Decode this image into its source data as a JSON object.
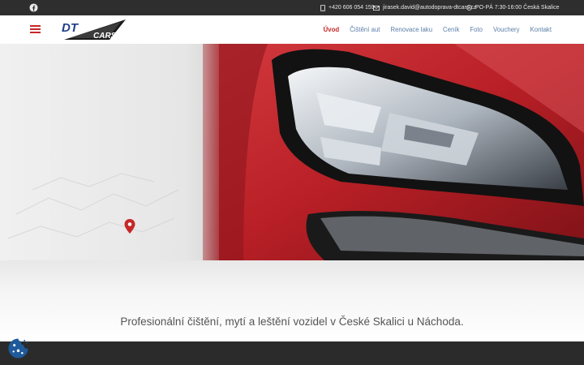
{
  "topbar": {
    "social_icon": "facebook-icon",
    "phone": "+420 606 054 159",
    "email": "jirasek.david@autodoprava-dtcars.cz",
    "hours": "PO-PÁ 7:30-16:00 Česká Skalice"
  },
  "header": {
    "logo_text": {
      "primary": "DT",
      "secondary": "CARS"
    },
    "nav": [
      {
        "label": "Úvod"
      },
      {
        "label": "Čištění aut"
      },
      {
        "label": "Renovace laku"
      },
      {
        "label": "Ceník"
      },
      {
        "label": "Foto"
      },
      {
        "label": "Vouchery"
      },
      {
        "label": "Kontakt"
      }
    ],
    "active_nav": "Úvod"
  },
  "hero": {
    "image": "red car headlight",
    "marker_icon": "location-pin-icon"
  },
  "tagline": "Profesionální čištění, mytí a leštění vozidel v České Skalici u Náchoda.",
  "cookie_icon": "cookie-icon",
  "colors": {
    "accent": "#c62828",
    "nav_link": "#5b7fa8",
    "topbar_bg": "#2e2e2e",
    "cookie": "#1f5a9a"
  }
}
